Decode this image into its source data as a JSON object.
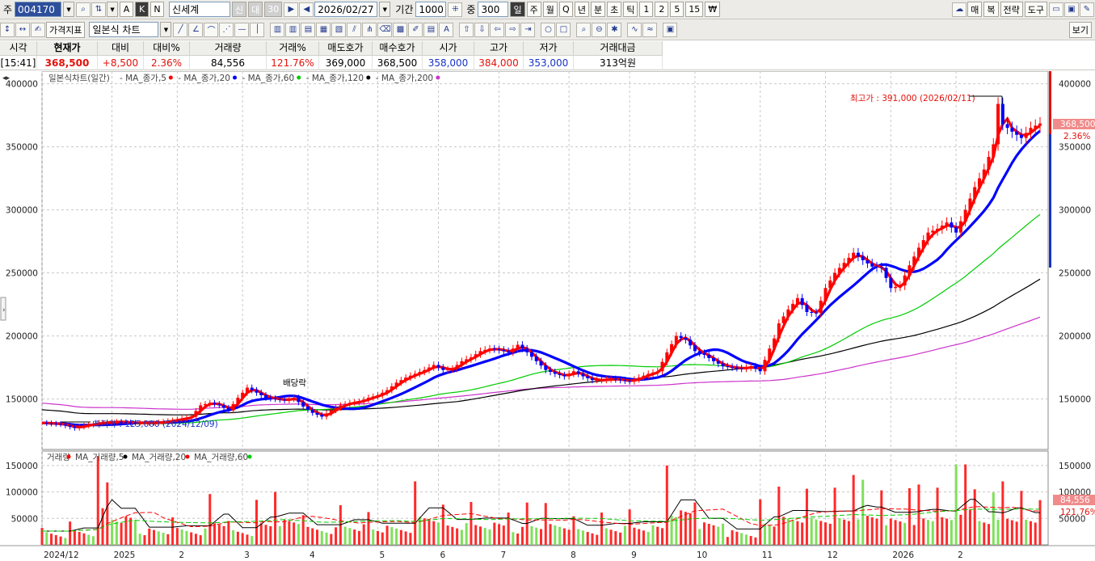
{
  "toolbar1": {
    "prefix_label": "주",
    "code_value": "004170",
    "stock_name": "신세계",
    "badges": [
      "신",
      "대",
      "30"
    ],
    "date_value": "2026/02/27",
    "period_label": "기간",
    "period_value": "1000",
    "count_label": "중",
    "count_value": "300",
    "periods": [
      "일",
      "주",
      "월",
      "Q",
      "년",
      "분",
      "초",
      "틱",
      "1",
      "2",
      "5",
      "15",
      "₩"
    ],
    "active_period": "일",
    "right_buttons": [
      "매",
      "복",
      "전략",
      "도구"
    ],
    "type_buttons": [
      "A",
      "K",
      "N"
    ]
  },
  "toolbar2": {
    "price_indicator_label": "가격지표",
    "chart_type_value": "일본식 차트",
    "view_button": "보기"
  },
  "quote": {
    "headers": [
      "시각",
      "현재가",
      "대비",
      "대비%",
      "거래량",
      "거래%",
      "매도호가",
      "매수호가",
      "시가",
      "고가",
      "저가",
      "거래대금"
    ],
    "values": [
      "[15:41]",
      "368,500",
      "+8,500",
      "2.36%",
      "84,556",
      "121.76%",
      "369,000",
      "368,500",
      "358,000",
      "384,000",
      "353,000",
      "313억원"
    ]
  },
  "icons": {
    "magnifier": "search-icon",
    "sort": "sort-icon",
    "play": "play-icon",
    "back": "back-icon",
    "cloud": "cloud-icon",
    "folder": "folder-icon",
    "save": "save-icon",
    "wrench": "wrench-icon"
  },
  "chart_data": [
    {
      "type": "candlestick",
      "legend_title": "일본식차트(일간)",
      "legend": [
        {
          "name": "MA_종가,5",
          "color": "#ff0000"
        },
        {
          "name": "MA_종가,20",
          "color": "#0000ff"
        },
        {
          "name": "MA_종가,60",
          "color": "#00cc00"
        },
        {
          "name": "MA_종가,120",
          "color": "#000000"
        },
        {
          "name": "MA_종가,200",
          "color": "#cc33cc"
        }
      ],
      "ylim": [
        110000,
        410000
      ],
      "y_ticks": [
        150000,
        200000,
        250000,
        300000,
        350000,
        400000
      ],
      "y_tick_labels": [
        "150000",
        "200000",
        "250000",
        "300000",
        "350000",
        "400000"
      ],
      "right_tick_labels": [
        "150000",
        "200000",
        "250000",
        "300000",
        "350000",
        "400000"
      ],
      "x_ticks": [
        "2024/12",
        "2025",
        "2",
        "3",
        "4",
        "5",
        "6",
        "7",
        "8",
        "9",
        "10",
        "11",
        "12",
        "2026",
        "2"
      ],
      "close_path": [
        [
          0,
          131000
        ],
        [
          4,
          130000
        ],
        [
          7,
          127000
        ],
        [
          9,
          129000
        ],
        [
          12,
          131000
        ],
        [
          16,
          132000
        ],
        [
          20,
          131000
        ],
        [
          24,
          131000
        ],
        [
          28,
          133000
        ],
        [
          32,
          136000
        ],
        [
          34,
          145000
        ],
        [
          36,
          147000
        ],
        [
          38,
          145000
        ],
        [
          40,
          141000
        ],
        [
          42,
          151000
        ],
        [
          44,
          159000
        ],
        [
          46,
          155000
        ],
        [
          48,
          151000
        ],
        [
          50,
          150000
        ],
        [
          52,
          149000
        ],
        [
          54,
          151000
        ],
        [
          56,
          144000
        ],
        [
          58,
          139000
        ],
        [
          60,
          136000
        ],
        [
          62,
          141000
        ],
        [
          64,
          145000
        ],
        [
          66,
          147000
        ],
        [
          68,
          148000
        ],
        [
          70,
          151000
        ],
        [
          72,
          153000
        ],
        [
          74,
          157000
        ],
        [
          76,
          163000
        ],
        [
          78,
          167000
        ],
        [
          80,
          170000
        ],
        [
          82,
          173000
        ],
        [
          84,
          177000
        ],
        [
          86,
          173000
        ],
        [
          88,
          174000
        ],
        [
          90,
          180000
        ],
        [
          92,
          183000
        ],
        [
          94,
          188000
        ],
        [
          96,
          190000
        ],
        [
          98,
          189000
        ],
        [
          100,
          187000
        ],
        [
          102,
          193000
        ],
        [
          104,
          187000
        ],
        [
          106,
          180000
        ],
        [
          108,
          173000
        ],
        [
          110,
          170000
        ],
        [
          112,
          168000
        ],
        [
          114,
          172000
        ],
        [
          116,
          168000
        ],
        [
          118,
          165000
        ],
        [
          120,
          165000
        ],
        [
          122,
          166000
        ],
        [
          124,
          165000
        ],
        [
          126,
          164000
        ],
        [
          128,
          167000
        ],
        [
          130,
          170000
        ],
        [
          132,
          172000
        ],
        [
          134,
          187000
        ],
        [
          136,
          200000
        ],
        [
          138,
          197000
        ],
        [
          140,
          188000
        ],
        [
          142,
          185000
        ],
        [
          144,
          180000
        ],
        [
          146,
          176000
        ],
        [
          148,
          175000
        ],
        [
          150,
          174000
        ],
        [
          152,
          176000
        ],
        [
          154,
          172000
        ],
        [
          156,
          190000
        ],
        [
          157,
          198000
        ],
        [
          158,
          210000
        ],
        [
          160,
          221000
        ],
        [
          162,
          230000
        ],
        [
          164,
          219000
        ],
        [
          166,
          218000
        ],
        [
          168,
          238000
        ],
        [
          170,
          250000
        ],
        [
          172,
          258000
        ],
        [
          174,
          266000
        ],
        [
          176,
          260000
        ],
        [
          178,
          255000
        ],
        [
          180,
          254000
        ],
        [
          182,
          238000
        ],
        [
          184,
          240000
        ],
        [
          186,
          256000
        ],
        [
          188,
          270000
        ],
        [
          190,
          282000
        ],
        [
          192,
          285000
        ],
        [
          194,
          290000
        ],
        [
          196,
          282000
        ],
        [
          198,
          300000
        ],
        [
          200,
          318000
        ],
        [
          202,
          332000
        ],
        [
          204,
          352000
        ],
        [
          205,
          384000
        ],
        [
          206,
          368000
        ],
        [
          208,
          362000
        ],
        [
          210,
          357000
        ],
        [
          212,
          365000
        ],
        [
          214,
          368500
        ]
      ],
      "volume_legend": [
        {
          "name": "거래량",
          "color": "#ff0000"
        },
        {
          "name": "MA_거래량,5",
          "color": "#000000"
        },
        {
          "name": "MA_거래량,20",
          "color": "#ff0000"
        },
        {
          "name": "MA_거래량,60",
          "color": "#00cc00"
        }
      ],
      "volume_ylim": [
        0,
        165000
      ],
      "volume_y_tick_labels": [
        "50000",
        "100000",
        "150000"
      ],
      "volume_right_tick_labels": [
        "50000",
        "100000",
        "150000"
      ],
      "volume_bars": [
        [
          0,
          32000,
          1
        ],
        [
          6,
          44000,
          1
        ],
        [
          12,
          167000,
          1
        ],
        [
          14,
          118000,
          1
        ],
        [
          20,
          47000,
          0
        ],
        [
          28,
          52000,
          1
        ],
        [
          36,
          96000,
          1
        ],
        [
          40,
          45000,
          1
        ],
        [
          46,
          85000,
          1
        ],
        [
          50,
          100000,
          1
        ],
        [
          56,
          56000,
          1
        ],
        [
          64,
          75000,
          1
        ],
        [
          70,
          62000,
          1
        ],
        [
          80,
          120000,
          1
        ],
        [
          86,
          76000,
          1
        ],
        [
          92,
          81000,
          1
        ],
        [
          100,
          61000,
          1
        ],
        [
          104,
          80000,
          1
        ],
        [
          108,
          79000,
          1
        ],
        [
          114,
          54000,
          1
        ],
        [
          120,
          61000,
          1
        ],
        [
          126,
          67000,
          1
        ],
        [
          134,
          150000,
          1
        ],
        [
          140,
          80000,
          1
        ],
        [
          146,
          40000,
          0
        ],
        [
          154,
          86000,
          1
        ],
        [
          158,
          110000,
          1
        ],
        [
          164,
          106000,
          1
        ],
        [
          170,
          108000,
          1
        ],
        [
          174,
          132000,
          1
        ],
        [
          176,
          123000,
          0
        ],
        [
          180,
          103000,
          1
        ],
        [
          186,
          107000,
          1
        ],
        [
          188,
          114000,
          1
        ],
        [
          192,
          108000,
          1
        ],
        [
          196,
          152000,
          0
        ],
        [
          198,
          152000,
          1
        ],
        [
          200,
          105000,
          1
        ],
        [
          204,
          99000,
          0
        ],
        [
          206,
          120000,
          1
        ],
        [
          210,
          102000,
          1
        ],
        [
          214,
          84556,
          1
        ]
      ],
      "current_price_label": "368,500",
      "current_change_label": "2.36%",
      "current_volume_label": "84,556",
      "current_volume_pct_label": "121.76%"
    }
  ],
  "annotations": {
    "high_label": "최고가 : 391,000 (2026/02/11)",
    "low_label": "최저가 : 125,000 (2024/12/09)",
    "dividend_label": "배당락"
  }
}
